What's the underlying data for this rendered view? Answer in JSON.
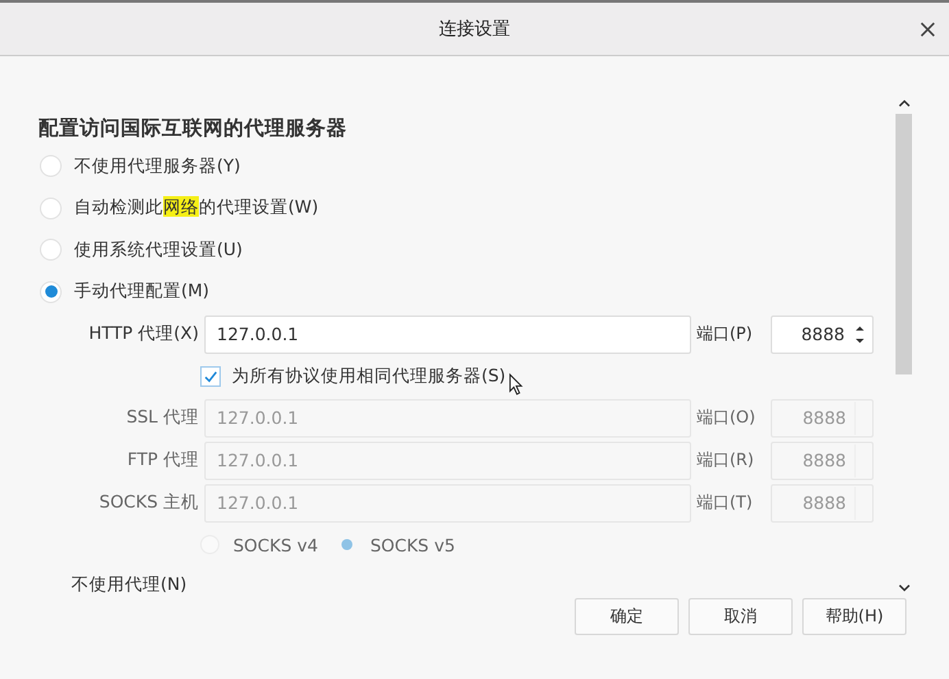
{
  "window": {
    "title": "连接设置"
  },
  "heading": "配置访问国际互联网的代理服务器",
  "proxy_modes": [
    {
      "parts": [
        {
          "text": "不使用代理服务器(Y)",
          "highlighted": false
        }
      ],
      "selected": false
    },
    {
      "parts": [
        {
          "text": "自动检测此",
          "highlighted": false
        },
        {
          "text": "网络",
          "highlighted": true
        },
        {
          "text": "的代理设置(W)",
          "highlighted": false
        }
      ],
      "selected": false
    },
    {
      "parts": [
        {
          "text": "使用系统代理设置(U)",
          "highlighted": false
        }
      ],
      "selected": false
    },
    {
      "parts": [
        {
          "text": "手动代理配置(M)",
          "highlighted": false
        }
      ],
      "selected": true
    }
  ],
  "proxies": [
    {
      "label": "HTTP 代理(X)",
      "value": "127.0.0.1",
      "port_label": "端口(P)",
      "port": "8888",
      "disabled": false
    },
    {
      "label": "SSL 代理",
      "value": "127.0.0.1",
      "port_label": "端口(O)",
      "port": "8888",
      "disabled": true
    },
    {
      "label": "FTP 代理",
      "value": "127.0.0.1",
      "port_label": "端口(R)",
      "port": "8888",
      "disabled": true
    },
    {
      "label": "SOCKS 主机",
      "value": "127.0.0.1",
      "port_label": "端口(T)",
      "port": "8888",
      "disabled": true
    }
  ],
  "share_checkbox": {
    "label": "为所有协议使用相同代理服务器(S)",
    "checked": true
  },
  "socks_versions": [
    {
      "label": "SOCKS v4",
      "selected": false
    },
    {
      "label": "SOCKS v5",
      "selected": true
    }
  ],
  "no_proxy_label": "不使用代理(N)",
  "buttons": [
    "确定",
    "取消",
    "帮助(H)"
  ]
}
